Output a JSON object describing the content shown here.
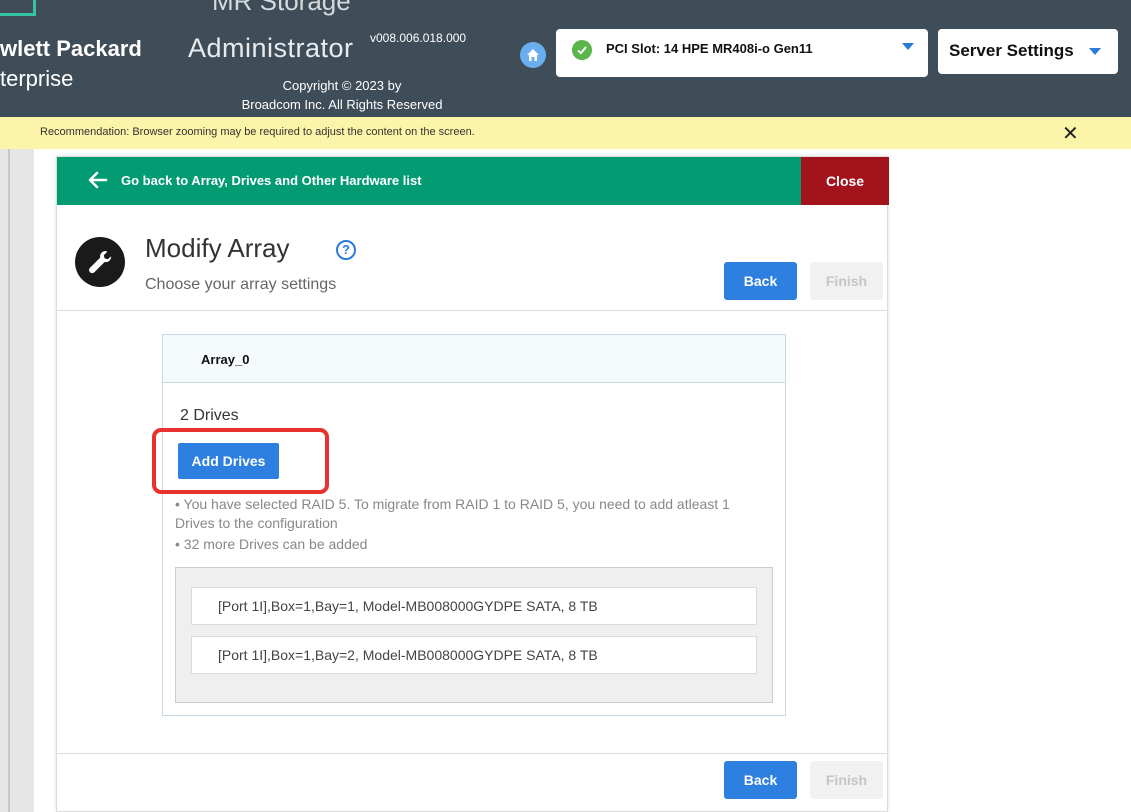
{
  "header": {
    "top_fragment": "MR Storage",
    "brand_line1": "wlett Packard",
    "brand_line2": "terprise",
    "app_name": "Administrator",
    "version": "v008.006.018.000",
    "copyright_line1": "Copyright © 2023 by",
    "copyright_line2": "Broadcom Inc. All Rights Reserved",
    "slot_select": "PCI Slot: 14 HPE MR408i-o Gen11",
    "server_settings": "Server Settings"
  },
  "recommendation": {
    "text": "Recommendation: Browser zooming may be required to adjust the content on the screen.",
    "close_symbol": "✕"
  },
  "panel": {
    "back_link": "Go back to Array, Drives and Other Hardware list",
    "close_label": "Close",
    "title": "Modify Array",
    "help_symbol": "?",
    "subtitle": "Choose your array settings",
    "back_label": "Back",
    "finish_label": "Finish"
  },
  "array": {
    "name": "Array_0",
    "drive_count": "2  Drives",
    "add_drives_label": "Add Drives",
    "info_lines": [
      "• You have selected RAID 5. To migrate from RAID 1 to RAID 5, you need to add atleast 1 Drives to the configuration",
      "• 32 more Drives can be added"
    ],
    "drives": [
      "[Port 1I],Box=1,Bay=1, Model-MB008000GYDPE SATA, 8 TB",
      "[Port 1I],Box=1,Bay=2, Model-MB008000GYDPE SATA, 8 TB"
    ]
  },
  "colors": {
    "header_bg": "#3f4d58",
    "nav_green": "#029b72",
    "close_red": "#a3131b",
    "button_blue": "#2d7fe0",
    "highlight_red": "#e8322f",
    "recommendation_yellow": "#fcf4a8"
  },
  "icons": {
    "home": "home-icon",
    "check": "check-circle-icon",
    "arrow": "arrow-left-icon",
    "wrench": "wrench-icon",
    "help": "help-circle-icon",
    "close": "close-icon",
    "caret": "caret-down-icon"
  }
}
